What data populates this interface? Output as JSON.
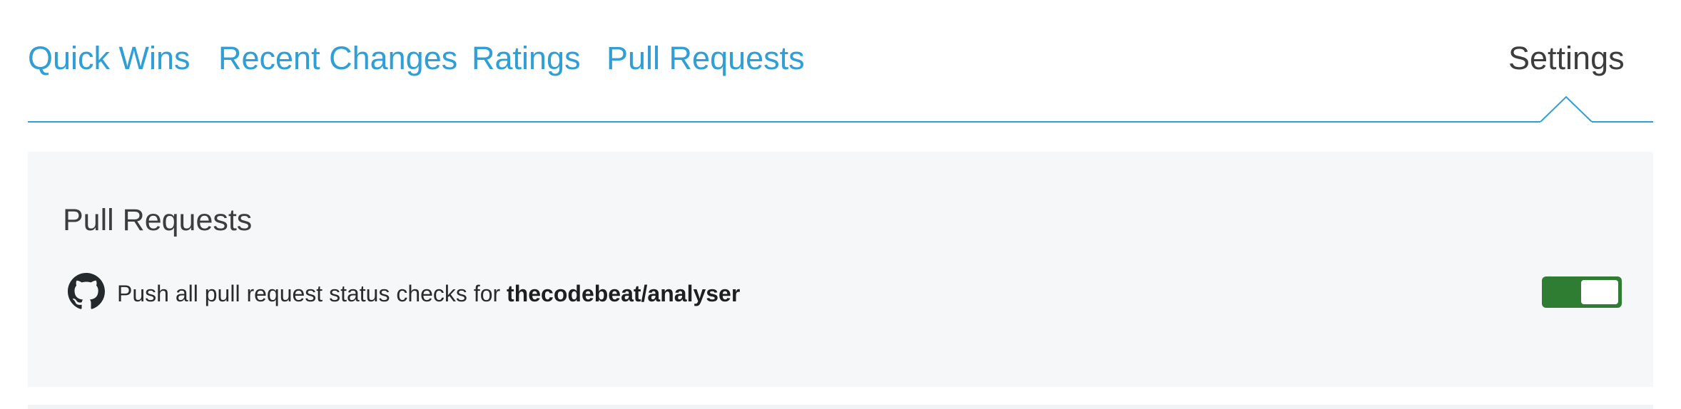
{
  "tabs": [
    {
      "label": "Quick Wins"
    },
    {
      "label": "Recent Changes"
    },
    {
      "label": "Ratings"
    },
    {
      "label": "Pull Requests"
    },
    {
      "label": "Settings",
      "active": true
    }
  ],
  "panel": {
    "title": "Pull Requests",
    "setting": {
      "icon": "github-icon",
      "text_prefix": "Push all pull request status checks for",
      "repo": "thecodebeat/analyser",
      "enabled": true
    }
  },
  "colors": {
    "link": "#2f9fd6",
    "active_tab": "#3d3d3d",
    "panel_bg": "#f6f7f8",
    "toggle_on": "#2e7d32"
  }
}
